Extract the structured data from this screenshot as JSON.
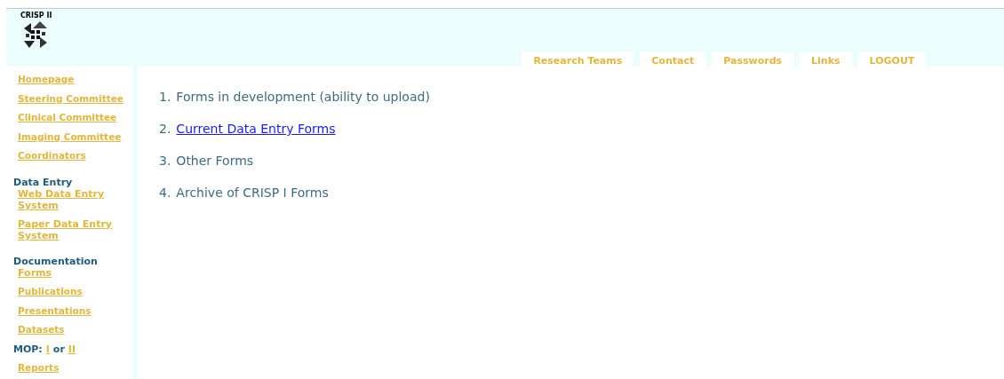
{
  "logo": {
    "text": "CRISP II"
  },
  "nav_tabs": [
    {
      "label": "Research Teams"
    },
    {
      "label": "Contact"
    },
    {
      "label": "Passwords"
    },
    {
      "label": "Links"
    },
    {
      "label": "LOGOUT"
    }
  ],
  "sidebar": {
    "items": [
      {
        "kind": "link",
        "label": "Homepage"
      },
      {
        "kind": "link",
        "label": "Steering Committee"
      },
      {
        "kind": "link",
        "label": "Clinical Committee"
      },
      {
        "kind": "link",
        "label": "Imaging Committee"
      },
      {
        "kind": "link",
        "label": "Coordinators"
      },
      {
        "kind": "heading",
        "label": "Data Entry"
      },
      {
        "kind": "sublink",
        "label": "Web Data Entry System"
      },
      {
        "kind": "sublink",
        "label": "Paper Data Entry System"
      },
      {
        "kind": "heading",
        "label": "Documentation"
      },
      {
        "kind": "sublink",
        "label": "Forms"
      },
      {
        "kind": "link",
        "label": "Publications"
      },
      {
        "kind": "link",
        "label": "Presentations"
      },
      {
        "kind": "link",
        "label": "Datasets"
      },
      {
        "kind": "mop",
        "label": "MOP:",
        "first": "I",
        "joiner": "or",
        "second": "II"
      },
      {
        "kind": "link",
        "label": "Reports"
      }
    ]
  },
  "content": {
    "items": [
      {
        "number": "1.",
        "label": "Forms in development (ability to upload)",
        "link": false
      },
      {
        "number": "2.",
        "label": "Current Data Entry Forms",
        "link": true
      },
      {
        "number": "3.",
        "label": "Other Forms",
        "link": false
      },
      {
        "number": "4.",
        "label": "Archive of CRISP I Forms",
        "link": false
      }
    ]
  }
}
